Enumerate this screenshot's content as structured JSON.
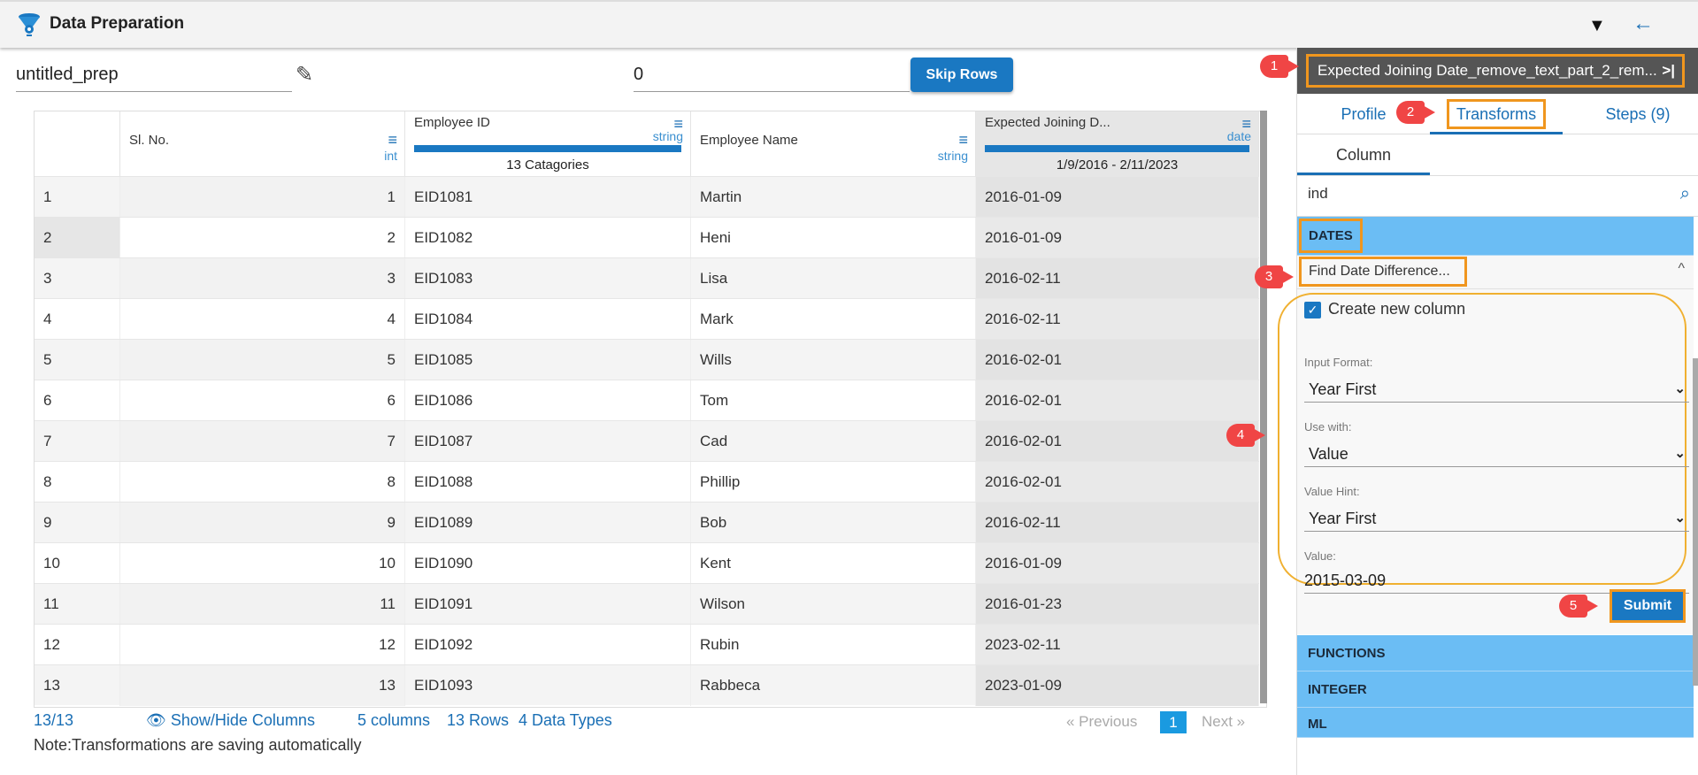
{
  "header": {
    "title": "Data Preparation",
    "icons": [
      "data-prep-logo-icon",
      "filter-icon",
      "back-arrow-icon"
    ]
  },
  "toolbar": {
    "prep_name": "untitled_prep",
    "skip_rows_value": "0",
    "skip_rows_label": "Skip Rows"
  },
  "table": {
    "columns": [
      {
        "name": "Sl. No.",
        "type": "int",
        "summary": ""
      },
      {
        "name": "Employee ID",
        "type": "string",
        "summary": "13 Catagories"
      },
      {
        "name": "Employee Name",
        "type": "string",
        "summary": ""
      },
      {
        "name": "Expected Joining D...",
        "type": "date",
        "summary": "1/9/2016 - 2/11/2023"
      }
    ],
    "rows": [
      [
        "1",
        "1",
        "EID1081",
        "Martin",
        "2016-01-09"
      ],
      [
        "2",
        "2",
        "EID1082",
        "Heni",
        "2016-01-09"
      ],
      [
        "3",
        "3",
        "EID1083",
        "Lisa",
        "2016-02-11"
      ],
      [
        "4",
        "4",
        "EID1084",
        "Mark",
        "2016-02-11"
      ],
      [
        "5",
        "5",
        "EID1085",
        "Wills",
        "2016-02-01"
      ],
      [
        "6",
        "6",
        "EID1086",
        "Tom",
        "2016-02-01"
      ],
      [
        "7",
        "7",
        "EID1087",
        "Cad",
        "2016-02-01"
      ],
      [
        "8",
        "8",
        "EID1088",
        "Phillip",
        "2016-02-01"
      ],
      [
        "9",
        "9",
        "EID1089",
        "Bob",
        "2016-02-11"
      ],
      [
        "10",
        "10",
        "EID1090",
        "Kent",
        "2016-01-09"
      ],
      [
        "11",
        "11",
        "EID1091",
        "Wilson",
        "2016-01-23"
      ],
      [
        "12",
        "12",
        "EID1092",
        "Rubin",
        "2023-02-11"
      ],
      [
        "13",
        "13",
        "EID1093",
        "Rabbeca",
        "2023-01-09"
      ]
    ]
  },
  "footer": {
    "count": "13/13",
    "show_hide": "Show/Hide Columns",
    "columns": "5 columns",
    "rows": "13 Rows",
    "types": "4 Data Types",
    "prev": "« Previous",
    "page": "1",
    "next": "Next »",
    "note": "Note:Transformations are saving automatically"
  },
  "panel": {
    "column_title": "Expected Joining Date_remove_text_part_2_rem...",
    "collapse_icon": ">|",
    "tabs": [
      "Profile",
      "Transforms",
      "Steps (9)"
    ],
    "subtab": "Column",
    "search_value": "ind",
    "sections": {
      "dates": "DATES",
      "functions": "FUNCTIONS",
      "integer": "INTEGER",
      "ml": "ML"
    },
    "transform": "Find Date Difference...",
    "form": {
      "create_new_column": "Create new column",
      "input_format_label": "Input Format:",
      "input_format": "Year First",
      "use_with_label": "Use with:",
      "use_with": "Value",
      "value_hint_label": "Value Hint:",
      "value_hint": "Year First",
      "value_label": "Value:",
      "value": "2015-03-09",
      "submit": "Submit"
    }
  },
  "annotations": [
    "1",
    "2",
    "3",
    "4",
    "5"
  ],
  "colors": {
    "accent": "#1a78c2",
    "highlight": "#f0961e",
    "section": "#6bbdf4",
    "marker": "#f04545"
  }
}
